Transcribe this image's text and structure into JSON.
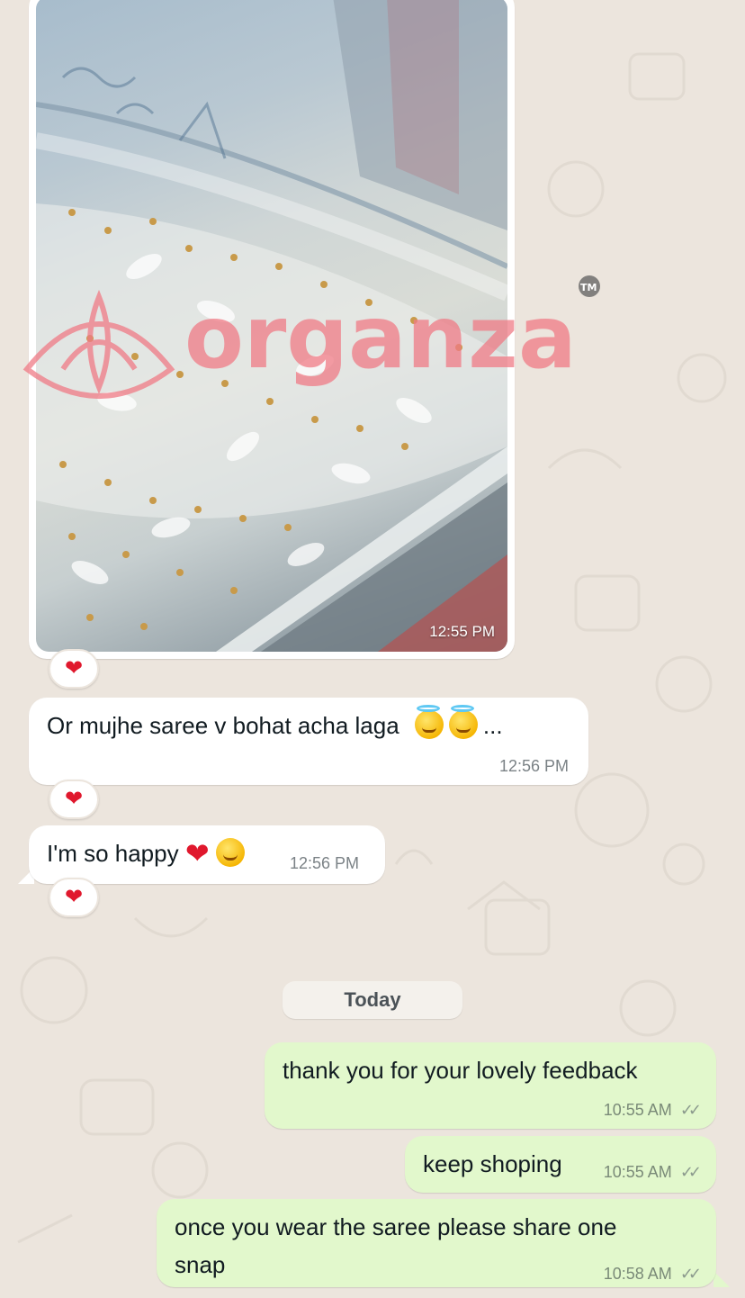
{
  "chat": {
    "image_message": {
      "time": "12:55 PM",
      "watermark_brand": "organza",
      "watermark_tm": "TM",
      "reaction": "❤"
    },
    "messages_in": [
      {
        "text": "Or mujhe saree v bohat acha laga",
        "trail": "...",
        "time": "12:56 PM",
        "reaction": "❤"
      },
      {
        "text": "I'm so happy",
        "heart": "❤",
        "time": "12:56 PM",
        "reaction": "❤"
      }
    ],
    "date_divider": "Today",
    "messages_out": [
      {
        "text": "thank you for your lovely feedback",
        "time": "10:55 AM",
        "status": "✓✓"
      },
      {
        "text": "keep shoping",
        "time": "10:55 AM",
        "status": "✓✓"
      },
      {
        "text_line1": "once you wear the saree please share one",
        "text_line2": "snap",
        "time": "10:58 AM",
        "status": "✓✓"
      }
    ]
  },
  "colors": {
    "wallpaper": "#ece5dd",
    "incoming_bubble": "#ffffff",
    "outgoing_bubble": "#e2f8cc",
    "reaction_heart": "#e0182d",
    "watermark": "#f07b86"
  }
}
